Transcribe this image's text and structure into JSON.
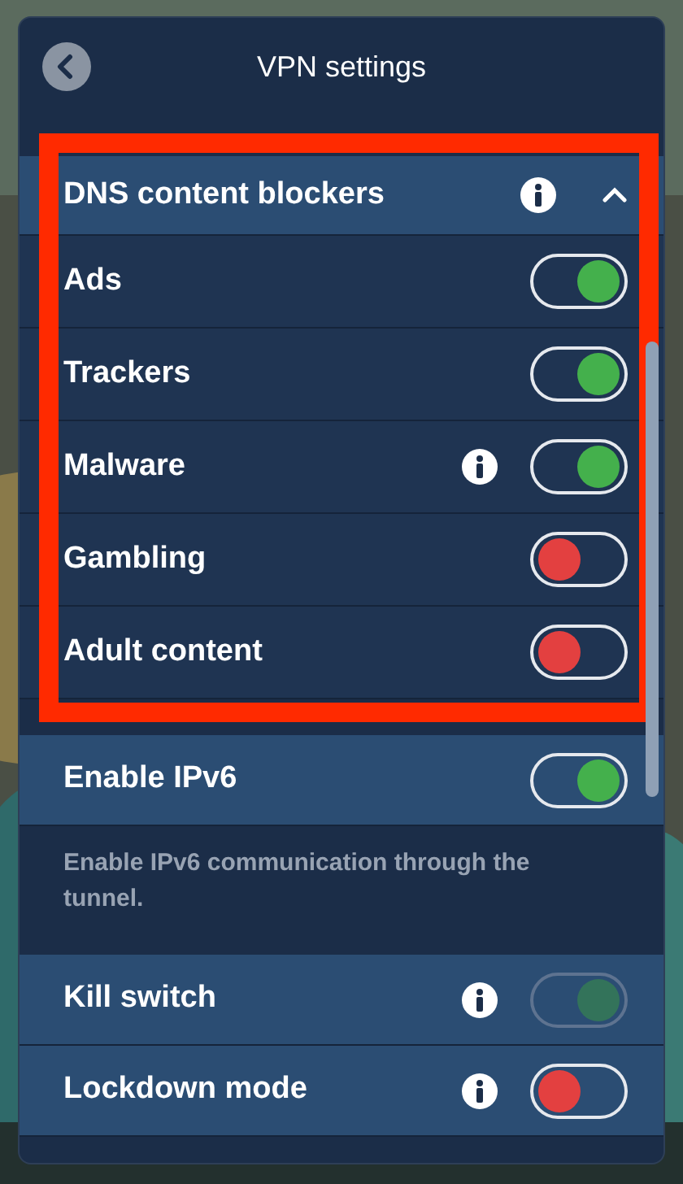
{
  "window": {
    "title": "VPN settings"
  },
  "dns_content_blockers": {
    "title": "DNS content blockers",
    "expanded": true,
    "highlighted": true,
    "items": [
      {
        "label": "Ads",
        "on": true,
        "info": false
      },
      {
        "label": "Trackers",
        "on": true,
        "info": false
      },
      {
        "label": "Malware",
        "on": true,
        "info": true
      },
      {
        "label": "Gambling",
        "on": false,
        "info": false
      },
      {
        "label": "Adult content",
        "on": false,
        "info": false
      }
    ]
  },
  "settings": [
    {
      "label": "Enable IPv6",
      "on": true,
      "info": false,
      "disabled": false,
      "description": "Enable IPv6 communication through the tunnel."
    },
    {
      "label": "Kill switch",
      "on": true,
      "info": true,
      "disabled": true
    },
    {
      "label": "Lockdown mode",
      "on": false,
      "info": true,
      "disabled": false
    }
  ]
}
